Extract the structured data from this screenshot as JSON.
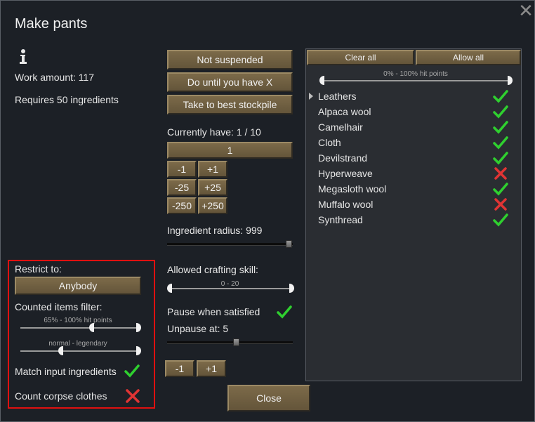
{
  "dialog": {
    "title": "Make pants"
  },
  "info": {
    "work_amount": "Work amount: 117",
    "requires": "Requires 50 ingredients"
  },
  "bill": {
    "suspend_label": "Not suspended",
    "repeat_mode_label": "Do until you have X",
    "store_mode_label": "Take to best stockpile",
    "currently_have": "Currently have: 1 / 10",
    "target_value": "1",
    "buttons": {
      "minus1": "-1",
      "plus1": "+1",
      "minus25": "-25",
      "plus25": "+25",
      "minus250": "-250",
      "plus250": "+250"
    },
    "ingredient_radius": "Ingredient radius: 999",
    "ingredient_radius_fraction": 1.0,
    "allowed_skill_label": "Allowed crafting skill:",
    "allowed_skill_range": "0 - 20",
    "pause_when_satisfied": "Pause when satisfied",
    "pause_checked": true,
    "unpause_at": "Unpause at: 5",
    "unpause_fraction": 0.5,
    "unpause_minus": "-1",
    "unpause_plus": "+1",
    "close_label": "Close"
  },
  "restrict": {
    "restrict_to_label": "Restrict to:",
    "restrict_to_value": "Anybody",
    "counted_filter_label": "Counted items filter:",
    "hitpoints_range": "65% - 100% hit points",
    "hitpoints_fraction": [
      0.65,
      1.0
    ],
    "quality_range": "normal - legendary",
    "quality_fraction": [
      0.33,
      1.0
    ],
    "match_input_label": "Match input ingredients",
    "match_input_checked": true,
    "count_corpse_label": "Count corpse clothes",
    "count_corpse_checked": false
  },
  "filter_panel": {
    "clear_all": "Clear all",
    "allow_all": "Allow all",
    "hitpoints_range": "0% - 100% hit points",
    "items": [
      {
        "label": "Leathers",
        "allowed": true,
        "expandable": true
      },
      {
        "label": "Alpaca wool",
        "allowed": true
      },
      {
        "label": "Camelhair",
        "allowed": true
      },
      {
        "label": "Cloth",
        "allowed": true
      },
      {
        "label": "Devilstrand",
        "allowed": true
      },
      {
        "label": "Hyperweave",
        "allowed": false
      },
      {
        "label": "Megasloth wool",
        "allowed": true
      },
      {
        "label": "Muffalo wool",
        "allowed": false
      },
      {
        "label": "Synthread",
        "allowed": true
      }
    ]
  },
  "colors": {
    "check": "#2fd02f",
    "cross": "#e03434",
    "button": "#6e5e40",
    "highlight_box": "#e01010"
  }
}
